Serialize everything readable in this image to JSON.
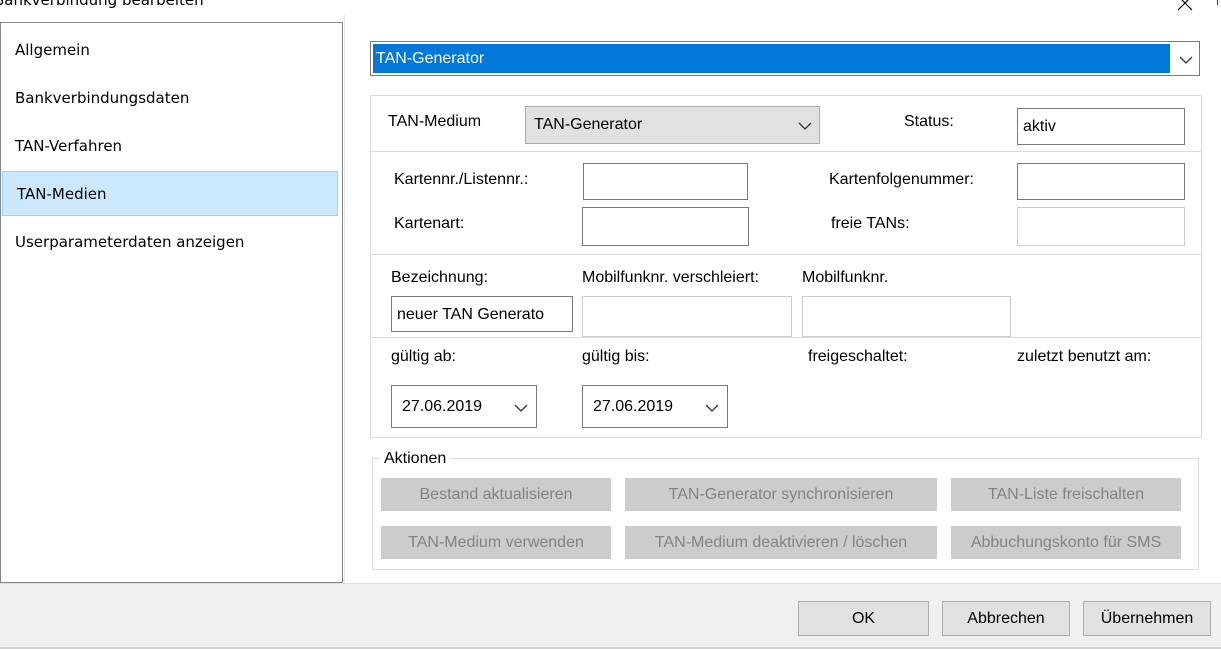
{
  "window": {
    "title": "Bankverbindung bearbeiten"
  },
  "nav": {
    "items": [
      {
        "label": "Allgemein"
      },
      {
        "label": "Bankverbindungsdaten"
      },
      {
        "label": "TAN-Verfahren"
      },
      {
        "label": "TAN-Medien"
      },
      {
        "label": "Userparameterdaten anzeigen"
      }
    ]
  },
  "main": {
    "medium_selector": "TAN-Generator",
    "tan_medium_label": "TAN-Medium",
    "tan_medium_value": "TAN-Generator",
    "status_label": "Status:",
    "status_value": "aktiv",
    "kartennr_label": "Kartennr./Listennr.:",
    "kartennr_value": "",
    "kartenfolge_label": "Kartenfolgenummer:",
    "kartenfolge_value": "",
    "kartenart_label": "Kartenart:",
    "kartenart_value": "",
    "freie_tans_label": "freie TANs:",
    "freie_tans_value": "",
    "bezeichnung_label": "Bezeichnung:",
    "bezeichnung_value": "neuer TAN Generato",
    "mobil_verschleiert_label": "Mobilfunknr. verschleiert:",
    "mobil_verschleiert_value": "",
    "mobil_label": "Mobilfunknr.",
    "mobil_value": "",
    "gueltig_ab_label": "gültig ab:",
    "gueltig_ab_value": "27.06.2019",
    "gueltig_bis_label": "gültig bis:",
    "gueltig_bis_value": "27.06.2019",
    "freigeschaltet_label": "freigeschaltet:",
    "zuletzt_label": "zuletzt benutzt am:"
  },
  "actions": {
    "title": "Aktionen",
    "bestand": "Bestand aktualisieren",
    "sync": "TAN-Generator synchronisieren",
    "liste": "TAN-Liste freischalten",
    "verwenden": "TAN-Medium verwenden",
    "deaktivieren": "TAN-Medium deaktivieren / löschen",
    "abbuchung": "Abbuchungskonto für SMS"
  },
  "footer": {
    "ok": "OK",
    "cancel": "Abbrechen",
    "apply": "Übernehmen"
  },
  "colors": {
    "selection": "#0078d7",
    "nav_selected": "#cce8ff"
  },
  "icons": {
    "close": "close-icon",
    "dropdown": "chevron-down-icon"
  }
}
